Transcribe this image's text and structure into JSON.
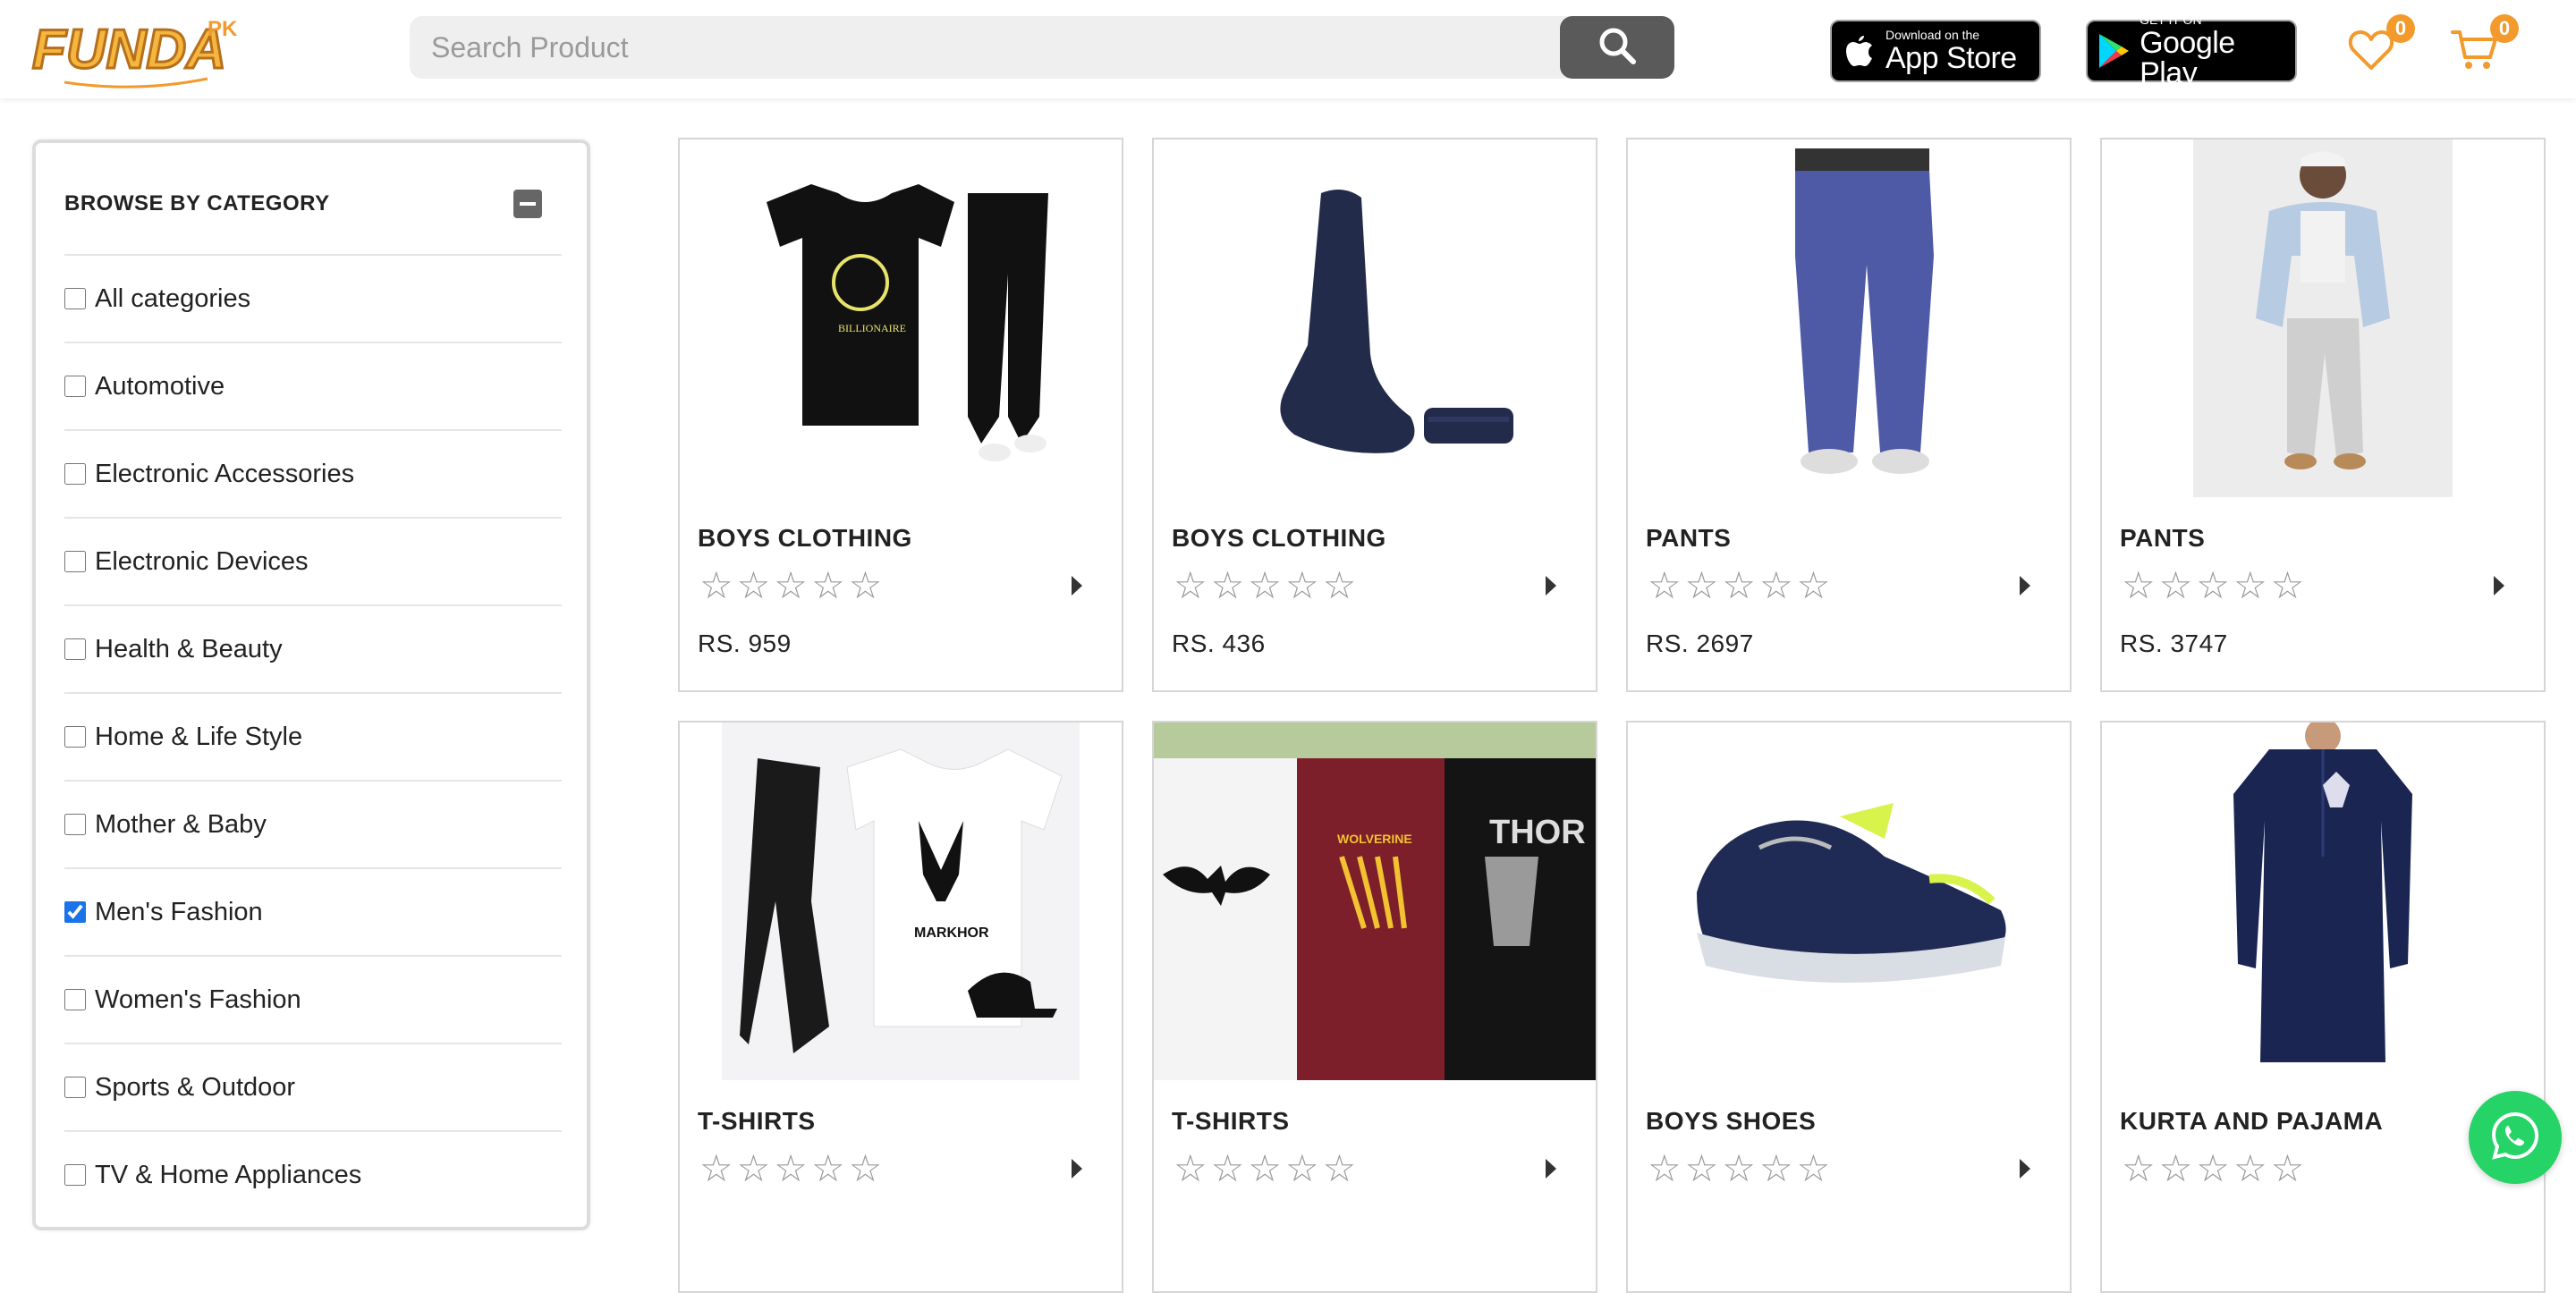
{
  "brand": {
    "logo_text": "FUNDA",
    "logo_suffix": "PK"
  },
  "search": {
    "placeholder": "Search Product",
    "value": ""
  },
  "app_badges": {
    "app_store": {
      "small": "Download on the",
      "big": "App Store"
    },
    "google_play": {
      "small": "GET IT ON",
      "big": "Google Play"
    }
  },
  "wishlist": {
    "count": "0"
  },
  "cart": {
    "count": "0"
  },
  "sidebar": {
    "title": "BROWSE BY CATEGORY",
    "categories": [
      {
        "label": "All categories",
        "checked": false
      },
      {
        "label": "Automotive",
        "checked": false
      },
      {
        "label": "Electronic Accessories",
        "checked": false
      },
      {
        "label": "Electronic Devices",
        "checked": false
      },
      {
        "label": "Health & Beauty",
        "checked": false
      },
      {
        "label": "Home & Life Style",
        "checked": false
      },
      {
        "label": "Mother & Baby",
        "checked": false
      },
      {
        "label": "Men's Fashion",
        "checked": true
      },
      {
        "label": "Women's Fashion",
        "checked": false
      },
      {
        "label": "Sports & Outdoor",
        "checked": false
      },
      {
        "label": "TV & Home Appliances",
        "checked": false
      }
    ]
  },
  "products": [
    {
      "title": "BOYS CLOTHING",
      "rating": "☆☆☆☆☆",
      "price": "RS. 959",
      "image": "black-tshirt-and-joggers"
    },
    {
      "title": "BOYS CLOTHING",
      "rating": "☆☆☆☆☆",
      "price": "RS. 436",
      "image": "navy-socks"
    },
    {
      "title": "PANTS",
      "rating": "☆☆☆☆☆",
      "price": "RS. 2697",
      "image": "blue-chino-pants"
    },
    {
      "title": "PANTS",
      "rating": "☆☆☆☆☆",
      "price": "RS. 3747",
      "image": "grey-joggers-denim-jacket"
    },
    {
      "title": "T-SHIRTS",
      "rating": "☆☆☆☆☆",
      "price": "",
      "image": "markhor-tshirt-set"
    },
    {
      "title": "T-SHIRTS",
      "rating": "☆☆☆☆☆",
      "price": "",
      "image": "superhero-tshirts"
    },
    {
      "title": "BOYS SHOES",
      "rating": "☆☆☆☆☆",
      "price": "",
      "image": "navy-sneaker"
    },
    {
      "title": "KURTA AND PAJAMA",
      "rating": "☆☆☆☆☆",
      "price": "",
      "image": "navy-kurta"
    }
  ],
  "colors": {
    "accent": "#f39a2c",
    "whatsapp": "#25d366",
    "checkbox": "#1a73e8"
  },
  "icons": {
    "search": "search-icon",
    "wishlist": "heart-icon",
    "cart": "cart-icon",
    "whatsapp": "whatsapp-icon",
    "collapse": "minus-icon"
  }
}
